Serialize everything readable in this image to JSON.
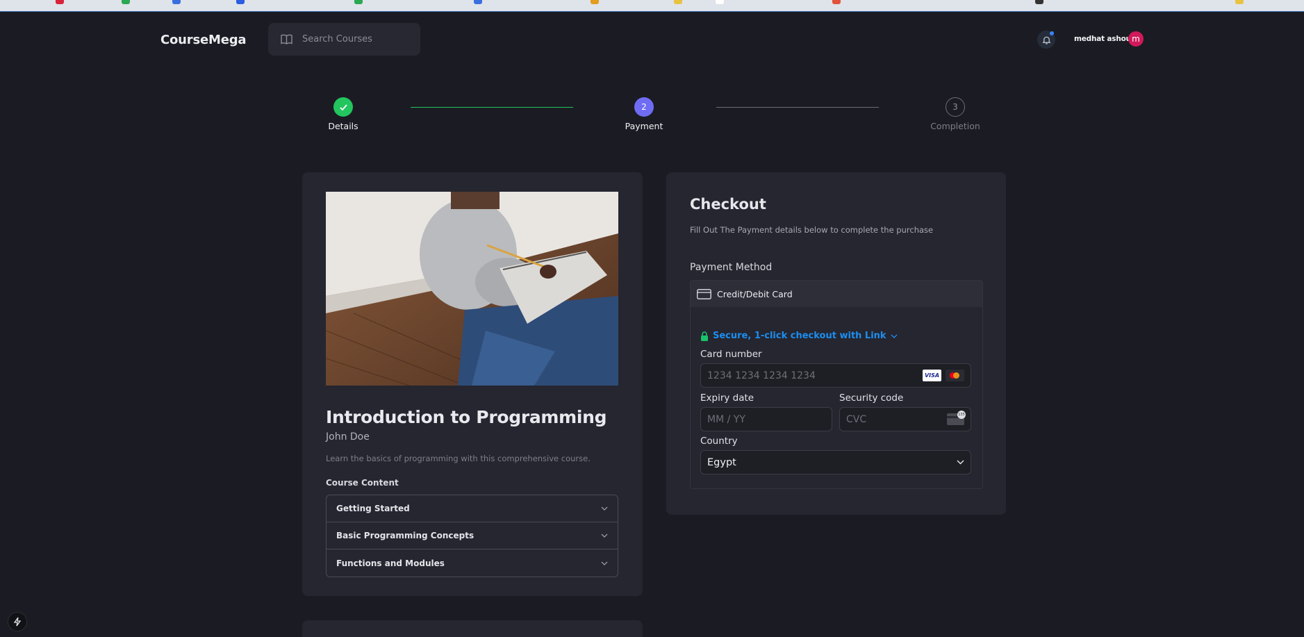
{
  "app": {
    "name": "CourseMega"
  },
  "search": {
    "placeholder": "Search Courses"
  },
  "user": {
    "name": "medhat ashour",
    "initial": "m",
    "has_notification": true
  },
  "stepper": {
    "steps": [
      {
        "label": "Details",
        "number": "1",
        "state": "completed"
      },
      {
        "label": "Payment",
        "number": "2",
        "state": "active"
      },
      {
        "label": "Completion",
        "number": "3",
        "state": "pending"
      }
    ],
    "colors": {
      "completed": "#22c55e",
      "active": "#6f6cf4",
      "pending": "#8d8e97"
    }
  },
  "course": {
    "title": "Introduction to Programming",
    "author": "John Doe",
    "description": "Learn the basics of programming with this comprehensive course.",
    "content_heading": "Course Content",
    "sections": [
      {
        "title": "Getting Started"
      },
      {
        "title": "Basic Programming Concepts"
      },
      {
        "title": "Functions and Modules"
      }
    ]
  },
  "checkout": {
    "title": "Checkout",
    "subtitle": "Fill Out The Payment details below to complete the purchase",
    "payment_method_label": "Payment Method",
    "method_tab": "Credit/Debit Card",
    "link_text": "Secure, 1-click checkout with Link",
    "card_number": {
      "label": "Card number",
      "placeholder": "1234 1234 1234 1234",
      "brands": [
        "VISA",
        "mastercard"
      ]
    },
    "expiry": {
      "label": "Expiry date",
      "placeholder": "MM / YY"
    },
    "security": {
      "label": "Security code",
      "placeholder": "CVC",
      "badge": "135"
    },
    "country": {
      "label": "Country",
      "value": "Egypt"
    }
  },
  "accent": {
    "link": "#1c8ef0",
    "lock": "#19c26b"
  }
}
